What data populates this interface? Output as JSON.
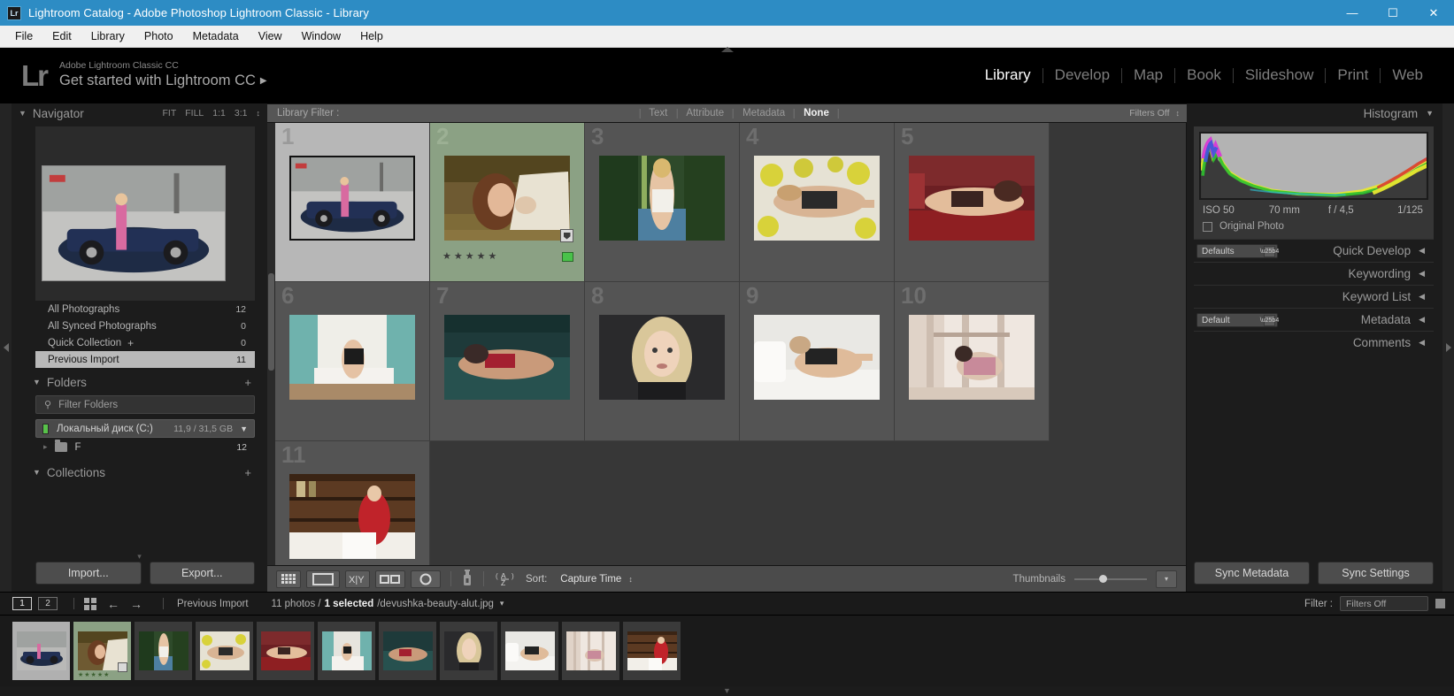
{
  "window": {
    "title": "Lightroom Catalog - Adobe Photoshop Lightroom Classic - Library",
    "app_badge": "Lr",
    "minimize": "—",
    "maximize": "☐",
    "close": "✕",
    "accent": "#2d8cc4"
  },
  "menubar": {
    "items": [
      "File",
      "Edit",
      "Library",
      "Photo",
      "Metadata",
      "View",
      "Window",
      "Help"
    ]
  },
  "identity": {
    "logo": "Lr",
    "small_line": "Adobe Lightroom Classic CC",
    "big_line": "Get started with Lightroom CC",
    "arrow": "▶"
  },
  "modules": {
    "items": [
      "Library",
      "Develop",
      "Map",
      "Book",
      "Slideshow",
      "Print",
      "Web"
    ],
    "active": "Library"
  },
  "navigator": {
    "title": "Navigator",
    "collapse_triangle": "▼",
    "zoom_modes": [
      "FIT",
      "FILL",
      "1:1",
      "3:1"
    ],
    "stepper": "↕"
  },
  "catalog": {
    "rows": [
      {
        "label": "All Photographs",
        "count": "12",
        "selected": false,
        "plus": ""
      },
      {
        "label": "All Synced Photographs",
        "count": "0",
        "selected": false,
        "plus": ""
      },
      {
        "label": "Quick Collection",
        "count": "0",
        "selected": false,
        "plus": "+"
      },
      {
        "label": "Previous Import",
        "count": "11",
        "selected": true,
        "plus": ""
      }
    ]
  },
  "folders": {
    "title": "Folders",
    "collapse_triangle": "▼",
    "add": "+",
    "filter_placeholder": "Filter Folders",
    "search_icon": "⚲",
    "volume": {
      "name": "Локальный диск (C:)",
      "size": "11,9 / 31,5 GB",
      "chevron": "▼"
    },
    "subfolder": {
      "name": "F",
      "count": "12",
      "disclosure": "▸"
    }
  },
  "collections": {
    "title": "Collections",
    "collapse_triangle": "▼",
    "add": "+"
  },
  "left_bottom": {
    "import": "Import...",
    "export": "Export...",
    "caret": "▾"
  },
  "library_filter": {
    "label": "Library Filter :",
    "tabs": [
      "Text",
      "Attribute",
      "Metadata",
      "None"
    ],
    "active_tab": "None",
    "filters_off": "Filters Off",
    "stepper": "↕",
    "lock_icon": "⚿"
  },
  "grid": {
    "cells": [
      {
        "number": "1",
        "state": "light",
        "stars": "",
        "flag": false,
        "green": false,
        "framed": true,
        "art": "car"
      },
      {
        "number": "2",
        "state": "selected",
        "stars": "★★★★★",
        "flag": true,
        "green": true,
        "framed": false,
        "art": "hay"
      },
      {
        "number": "3",
        "state": "normal",
        "stars": "",
        "flag": false,
        "green": false,
        "framed": false,
        "art": "pool"
      },
      {
        "number": "4",
        "state": "normal",
        "stars": "",
        "flag": false,
        "green": false,
        "framed": false,
        "art": "bed-yellow"
      },
      {
        "number": "5",
        "state": "normal",
        "stars": "",
        "flag": false,
        "green": false,
        "framed": false,
        "art": "red-sofa"
      },
      {
        "number": "6",
        "state": "normal",
        "stars": "",
        "flag": false,
        "green": false,
        "framed": false,
        "art": "teal-room"
      },
      {
        "number": "7",
        "state": "normal",
        "stars": "",
        "flag": false,
        "green": false,
        "framed": false,
        "art": "teal-couch"
      },
      {
        "number": "8",
        "state": "normal",
        "stars": "",
        "flag": false,
        "green": false,
        "framed": false,
        "art": "portrait"
      },
      {
        "number": "9",
        "state": "normal",
        "stars": "",
        "flag": false,
        "green": false,
        "framed": false,
        "art": "white-bed"
      },
      {
        "number": "10",
        "state": "normal",
        "stars": "",
        "flag": false,
        "green": false,
        "framed": false,
        "art": "stairs"
      },
      {
        "number": "11",
        "state": "normal",
        "stars": "",
        "flag": false,
        "green": false,
        "framed": false,
        "art": "red-dress"
      }
    ]
  },
  "toolbar": {
    "grid_view_icon": "grid-view-icon",
    "loupe_view_icon": "loupe-view-icon",
    "compare_view_icon": "compare-view-icon",
    "survey_view_icon": "survey-view-icon",
    "people_view_icon": "people-view-icon",
    "spray_icon": "spray-can-icon",
    "sort_icon": "AZ",
    "sort_label": "Sort:",
    "sort_value": "Capture Time",
    "sort_stepper": "↕",
    "thumbnails_label": "Thumbnails",
    "caret": "▾"
  },
  "histogram": {
    "title": "Histogram",
    "triangle": "▼",
    "iso": "ISO 50",
    "focal": "70 mm",
    "aperture": "f / 4,5",
    "shutter": "1/125",
    "original_photo": "Original Photo"
  },
  "right_sections": [
    {
      "title": "Quick Develop",
      "preset": "Defaults",
      "has_preset": true,
      "has_plus": false,
      "triangle": "◀"
    },
    {
      "title": "Keywording",
      "preset": "",
      "has_preset": false,
      "has_plus": false,
      "triangle": "◀"
    },
    {
      "title": "Keyword List",
      "preset": "",
      "has_preset": false,
      "has_plus": true,
      "triangle": "◀"
    },
    {
      "title": "Metadata",
      "preset": "Default",
      "has_preset": true,
      "has_plus": false,
      "triangle": "◀"
    },
    {
      "title": "Comments",
      "preset": "",
      "has_preset": false,
      "has_plus": false,
      "triangle": "◀"
    }
  ],
  "right_bottom": {
    "sync_metadata": "Sync Metadata",
    "sync_settings": "Sync Settings"
  },
  "filmstrip": {
    "page_buttons": [
      "1",
      "2"
    ],
    "grid_icon": "grid-icon",
    "back_arrow": "←",
    "forward_arrow": "→",
    "source": "Previous Import",
    "photo_count": "11 photos /",
    "selected_count": "1 selected",
    "filename": "/devushka-beauty-alut.jpg",
    "filename_caret": "▾",
    "filter_label": "Filter :",
    "filter_value": "Filters Off",
    "cells": [
      {
        "state": "lite",
        "art": "car",
        "stars": "",
        "badge": false
      },
      {
        "state": "sel",
        "art": "hay",
        "stars": "★★★★★",
        "badge": true
      },
      {
        "state": "",
        "art": "pool",
        "stars": "",
        "badge": false
      },
      {
        "state": "",
        "art": "bed-yellow",
        "stars": "",
        "badge": false
      },
      {
        "state": "",
        "art": "red-sofa",
        "stars": "",
        "badge": false
      },
      {
        "state": "",
        "art": "teal-room",
        "stars": "",
        "badge": false
      },
      {
        "state": "",
        "art": "teal-couch",
        "stars": "",
        "badge": false
      },
      {
        "state": "",
        "art": "portrait",
        "stars": "",
        "badge": false
      },
      {
        "state": "",
        "art": "white-bed",
        "stars": "",
        "badge": false
      },
      {
        "state": "",
        "art": "stairs",
        "stars": "",
        "badge": false
      },
      {
        "state": "",
        "art": "red-dress",
        "stars": "",
        "badge": false
      }
    ]
  },
  "bottom_caret": "▼"
}
